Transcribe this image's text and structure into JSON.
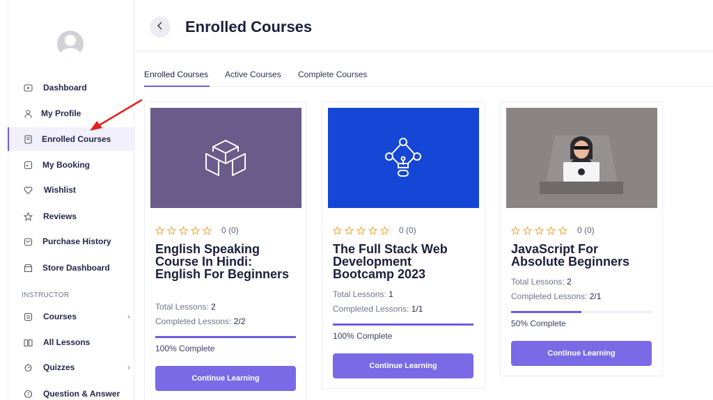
{
  "sidebar": {
    "items": [
      {
        "label": "Dashboard",
        "icon": "dashboard-icon"
      },
      {
        "label": "My Profile",
        "icon": "user-icon"
      },
      {
        "label": "Enrolled Courses",
        "icon": "book-icon",
        "active": true
      },
      {
        "label": "My Booking",
        "icon": "booking-icon"
      },
      {
        "label": "Wishlist",
        "icon": "heart-icon"
      },
      {
        "label": "Reviews",
        "icon": "star-icon"
      },
      {
        "label": "Purchase History",
        "icon": "cart-icon"
      },
      {
        "label": "Store Dashboard",
        "icon": "store-icon"
      }
    ],
    "instructor_label": "INSTRUCTOR",
    "instructor_items": [
      {
        "label": "Courses",
        "icon": "courses-icon",
        "has_submenu": true
      },
      {
        "label": "All Lessons",
        "icon": "lessons-icon"
      },
      {
        "label": "Quizzes",
        "icon": "quiz-icon",
        "has_submenu": true
      },
      {
        "label": "Question & Answer",
        "icon": "question-icon"
      }
    ]
  },
  "header": {
    "title": "Enrolled Courses"
  },
  "tabs": [
    {
      "label": "Enrolled Courses",
      "active": true
    },
    {
      "label": "Active Courses"
    },
    {
      "label": "Complete Courses"
    }
  ],
  "courses": [
    {
      "rating_text": "0 (0)",
      "title": "English Speaking Course In Hindi: English For Beginners",
      "total_lessons_label": "Total Lessons:",
      "total_lessons": "2",
      "completed_label": "Completed Lessons:",
      "completed": "2/2",
      "progress": 1.0,
      "complete_text": "100% Complete",
      "cta": "Continue Learning",
      "thumb_color": "#6b5b8a"
    },
    {
      "rating_text": "0 (0)",
      "title": "The Full Stack Web Development Bootcamp 2023",
      "total_lessons_label": "Total Lessons:",
      "total_lessons": "1",
      "completed_label": "Completed Lessons:",
      "completed": "1/1",
      "progress": 1.0,
      "complete_text": "100% Complete",
      "cta": "Continue Learning",
      "thumb_color": "#1646d6"
    },
    {
      "rating_text": "0 (0)",
      "title": "JavaScript For Absolute Beginners",
      "total_lessons_label": "Total Lessons:",
      "total_lessons": "2",
      "completed_label": "Completed Lessons:",
      "completed": "2/1",
      "progress": 0.5,
      "complete_text": "50% Complete",
      "cta": "Continue Learning",
      "thumb_color": "#8a8583"
    }
  ],
  "colors": {
    "accent": "#6e5ce0",
    "button": "#7a6ae6",
    "annotation_arrow": "#e0231c"
  }
}
